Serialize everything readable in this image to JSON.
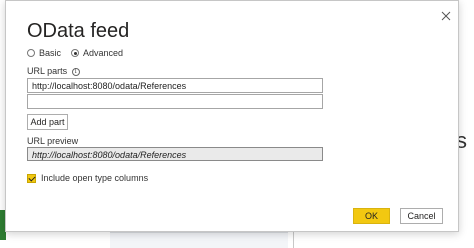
{
  "dialog": {
    "title": "OData feed",
    "mode_options": [
      {
        "label": "Basic",
        "selected": false
      },
      {
        "label": "Advanced",
        "selected": true
      }
    ],
    "url_parts_label": "URL parts",
    "url_parts": [
      {
        "value": "http://localhost:8080/odata/References"
      },
      {
        "value": ""
      }
    ],
    "add_part_label": "Add part",
    "url_preview_label": "URL preview",
    "url_preview_value": "http://localhost:8080/odata/References",
    "include_open_type_label": "Include open type columns",
    "include_open_type_checked": true,
    "ok_label": "OK",
    "cancel_label": "Cancel"
  },
  "background": {
    "peek_text": "s p"
  },
  "colors": {
    "accent": "#f2c811",
    "preview_bg": "#eaeaea"
  }
}
